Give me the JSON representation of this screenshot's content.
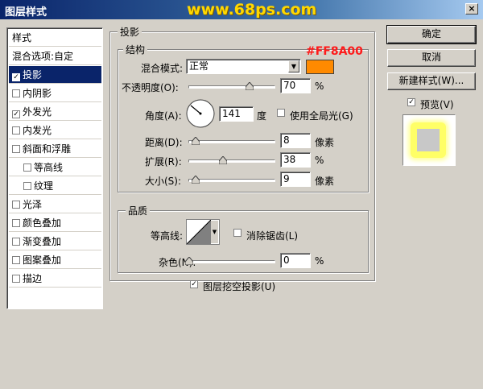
{
  "window": {
    "title": "图层样式",
    "watermark": "www.68ps.com",
    "close_glyph": "×"
  },
  "sidebar": {
    "header": "样式",
    "items": [
      {
        "label": "混合选项:自定",
        "checkbox": false,
        "checked": false,
        "sub": false,
        "selected": false
      },
      {
        "label": "投影",
        "checkbox": true,
        "checked": true,
        "sub": false,
        "selected": true
      },
      {
        "label": "内阴影",
        "checkbox": true,
        "checked": false,
        "sub": false,
        "selected": false
      },
      {
        "label": "外发光",
        "checkbox": true,
        "checked": true,
        "sub": false,
        "selected": false
      },
      {
        "label": "内发光",
        "checkbox": true,
        "checked": false,
        "sub": false,
        "selected": false
      },
      {
        "label": "斜面和浮雕",
        "checkbox": true,
        "checked": false,
        "sub": false,
        "selected": false
      },
      {
        "label": "等高线",
        "checkbox": true,
        "checked": false,
        "sub": true,
        "selected": false
      },
      {
        "label": "纹理",
        "checkbox": true,
        "checked": false,
        "sub": true,
        "selected": false
      },
      {
        "label": "光泽",
        "checkbox": true,
        "checked": false,
        "sub": false,
        "selected": false
      },
      {
        "label": "颜色叠加",
        "checkbox": true,
        "checked": false,
        "sub": false,
        "selected": false
      },
      {
        "label": "渐变叠加",
        "checkbox": true,
        "checked": false,
        "sub": false,
        "selected": false
      },
      {
        "label": "图案叠加",
        "checkbox": true,
        "checked": false,
        "sub": false,
        "selected": false
      },
      {
        "label": "描边",
        "checkbox": true,
        "checked": false,
        "sub": false,
        "selected": false
      }
    ]
  },
  "drop_shadow": {
    "title": "投影",
    "structure": {
      "title": "结构",
      "blend_mode_label": "混合模式:",
      "blend_mode_value": "正常",
      "hex_annotation": "#FF8A00",
      "swatch_color": "#ff8a00",
      "opacity_label": "不透明度(O):",
      "opacity_value": "70",
      "opacity_unit": "%",
      "opacity_fraction": 0.7,
      "angle_label": "角度(A):",
      "angle_value": "141",
      "angle_unit": "度",
      "use_global_light_label": "使用全局光(G)",
      "use_global_light_checked": false,
      "distance_label": "距离(D):",
      "distance_value": "8",
      "distance_unit": "像素",
      "spread_label": "扩展(R):",
      "spread_value": "38",
      "spread_unit": "%",
      "size_label": "大小(S):",
      "size_value": "9",
      "size_unit": "像素"
    },
    "quality": {
      "title": "品质",
      "contour_label": "等高线:",
      "antialias_label": "消除锯齿(L)",
      "antialias_checked": false,
      "noise_label": "杂色(N):",
      "noise_value": "0",
      "noise_unit": "%"
    },
    "knockout_label": "图层挖空投影(U)",
    "knockout_checked": true
  },
  "buttons": {
    "ok": "确定",
    "cancel": "取消",
    "new_style": "新建样式(W)...",
    "preview_label": "预览(V)",
    "preview_checked": true
  },
  "check_glyph": "✓",
  "colors": {
    "title_bar": "#0a246a",
    "selection": "#0a246a",
    "watermark": "#ffd800",
    "hex_text": "#ff1a1a",
    "preview_glow": "#ffff66"
  }
}
